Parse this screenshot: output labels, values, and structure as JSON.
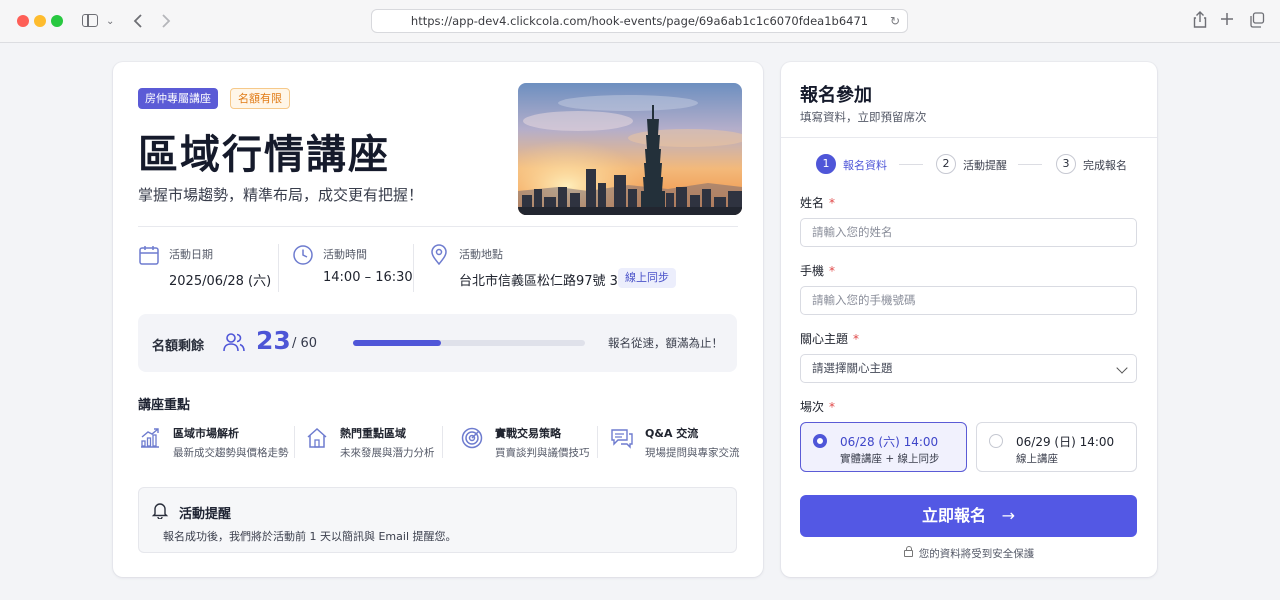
{
  "browser": {
    "url": "https://app-dev4.clickcola.com/hook-events/page/69a6ab1c1c6070fdea1b6471",
    "back_icon": "chevron-left",
    "forward_icon": "chevron-right"
  },
  "event": {
    "tags": [
      "房仲專屬講座",
      "名額有限"
    ],
    "title": "區域行情講座",
    "subtitle": "掌握市場趨勢，精準布局，成交更有把握！",
    "date_label": "活動日期",
    "date_value": "2025/06/28 (六)",
    "time_label": "活動時間",
    "time_value": "14:00 – 16:30",
    "location_label": "活動地點",
    "location_value": "台北市信義區松仁路97號 3F",
    "online_badge": "線上同步"
  },
  "quota": {
    "label": "名額剩餘",
    "remaining": "23",
    "total": "/ 60",
    "progress": 0.38,
    "note": "報名從速，額滿為止！"
  },
  "highlights": {
    "title": "講座重點",
    "items": [
      {
        "title": "區域市場解析",
        "desc": "最新成交趨勢與價格走勢",
        "icon": "chart-up-icon"
      },
      {
        "title": "熱門重點區域",
        "desc": "未來發展與潛力分析",
        "icon": "home-icon"
      },
      {
        "title": "實戰交易策略",
        "desc": "買賣談判與議價技巧",
        "icon": "target-icon"
      },
      {
        "title": "Q&A 交流",
        "desc": "現場提問與專家交流",
        "icon": "chat-icon"
      }
    ]
  },
  "reminder": {
    "title": "活動提醒",
    "text": "報名成功後，我們將於活動前 1 天以簡訊與 Email 提醒您。"
  },
  "form": {
    "title": "報名參加",
    "subtitle": "填寫資料，立即預留席次",
    "steps": [
      {
        "num": "1",
        "label": "報名資料",
        "active": true
      },
      {
        "num": "2",
        "label": "活動提醒",
        "active": false
      },
      {
        "num": "3",
        "label": "完成報名",
        "active": false
      }
    ],
    "name_label": "姓名",
    "name_placeholder": "請輸入您的姓名",
    "phone_label": "手機",
    "phone_placeholder": "請輸入您的手機號碼",
    "topic_label": "關心主題",
    "topic_placeholder": "請選擇關心主題",
    "session_label": "場次",
    "required_mark": "*",
    "sessions": [
      {
        "date": "06/28 (六) 14:00",
        "type": "實體講座 + 線上同步",
        "selected": true
      },
      {
        "date": "06/29 (日) 14:00",
        "type": "線上講座",
        "selected": false
      }
    ],
    "submit": "立即報名",
    "submit_arrow": "→",
    "security_note": "您的資料將受到安全保護"
  },
  "colors": {
    "accent": "#5358e4",
    "tag_orange": "#e07b16",
    "required": "#e04848"
  }
}
